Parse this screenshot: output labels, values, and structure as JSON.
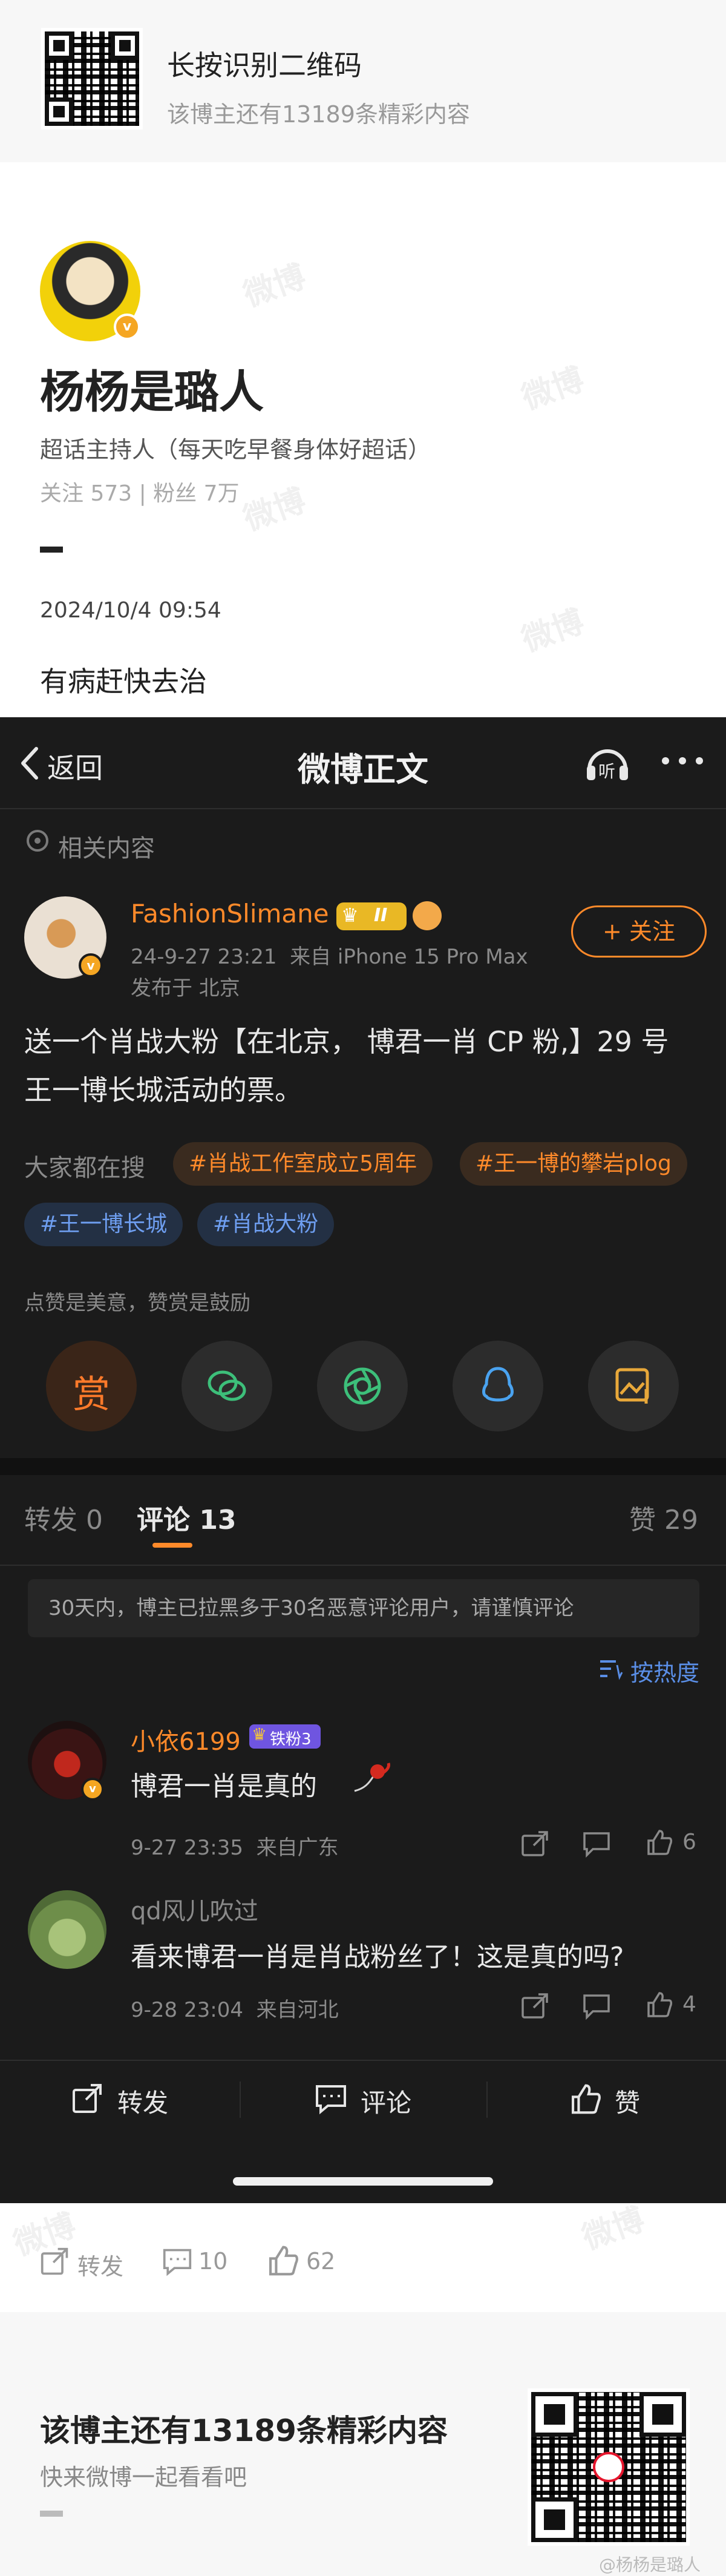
{
  "banner": {
    "title": "长按识别二维码",
    "subtitle": "该博主还有13189条精彩内容"
  },
  "author": {
    "name": "杨杨是璐人",
    "description": "超话主持人（每天吃早餐身体好超话）",
    "stats": "关注 573 | 粉丝 7万",
    "post_time": "2024/10/4 09:54",
    "post_text": "有病赶快去治",
    "watermark": "微博"
  },
  "embedded": {
    "back_label": "返回",
    "page_title": "微博正文",
    "listen_label": "听",
    "related_label": "相关内容",
    "poster": {
      "name": "FashionSlimane",
      "level_badge": "II",
      "meta": "24-9-27 23:21  来自 iPhone 15 Pro Max",
      "location": "发布于 北京",
      "follow_label": "+ 关注",
      "content_line1": "送一个肖战大粉【在北京， 博君一肖 CP 粉,】29 号",
      "content_line2": "王一博长城活动的票。"
    },
    "search": {
      "label": "大家都在搜",
      "chips": [
        "#肖战工作室成立5周年",
        "#王一博的攀岩plog",
        "#王一博长城",
        "#肖战大粉"
      ]
    },
    "reward_text": "点赞是美意，赞赏是鼓励",
    "reward_button": "赏",
    "tabs": {
      "repost": "转发 0",
      "comment": "评论 13",
      "like": "赞 29"
    },
    "notice": "30天内，博主已拉黑多于30名恶意评论用户，请谨慎评论",
    "sort_label": "按热度",
    "comments": [
      {
        "user": "小依6199",
        "fan_badge": "铁粉3",
        "text": "博君一肖是真的",
        "meta": "9-27 23:35  来自广东",
        "likes": "6"
      },
      {
        "user": "qd风儿吹过",
        "text": "看来博君一肖是肖战粉丝了！这是真的吗?",
        "meta": "9-28 23:04  来自河北",
        "likes": "4"
      }
    ],
    "bottom_bar": {
      "repost": "转发",
      "comment": "评论",
      "like": "赞"
    }
  },
  "footer_actions": {
    "repost": "转发",
    "comments": "10",
    "likes": "62"
  },
  "bottom_banner": {
    "title": "该博主还有13189条精彩内容",
    "subtitle": "快来微博一起看看吧",
    "watermark": "@杨杨是璐人"
  },
  "colors": {
    "accent_orange": "#ff8a2a",
    "dark_bg": "#1b1b1b",
    "chip_blue": "#6e9ef0"
  }
}
